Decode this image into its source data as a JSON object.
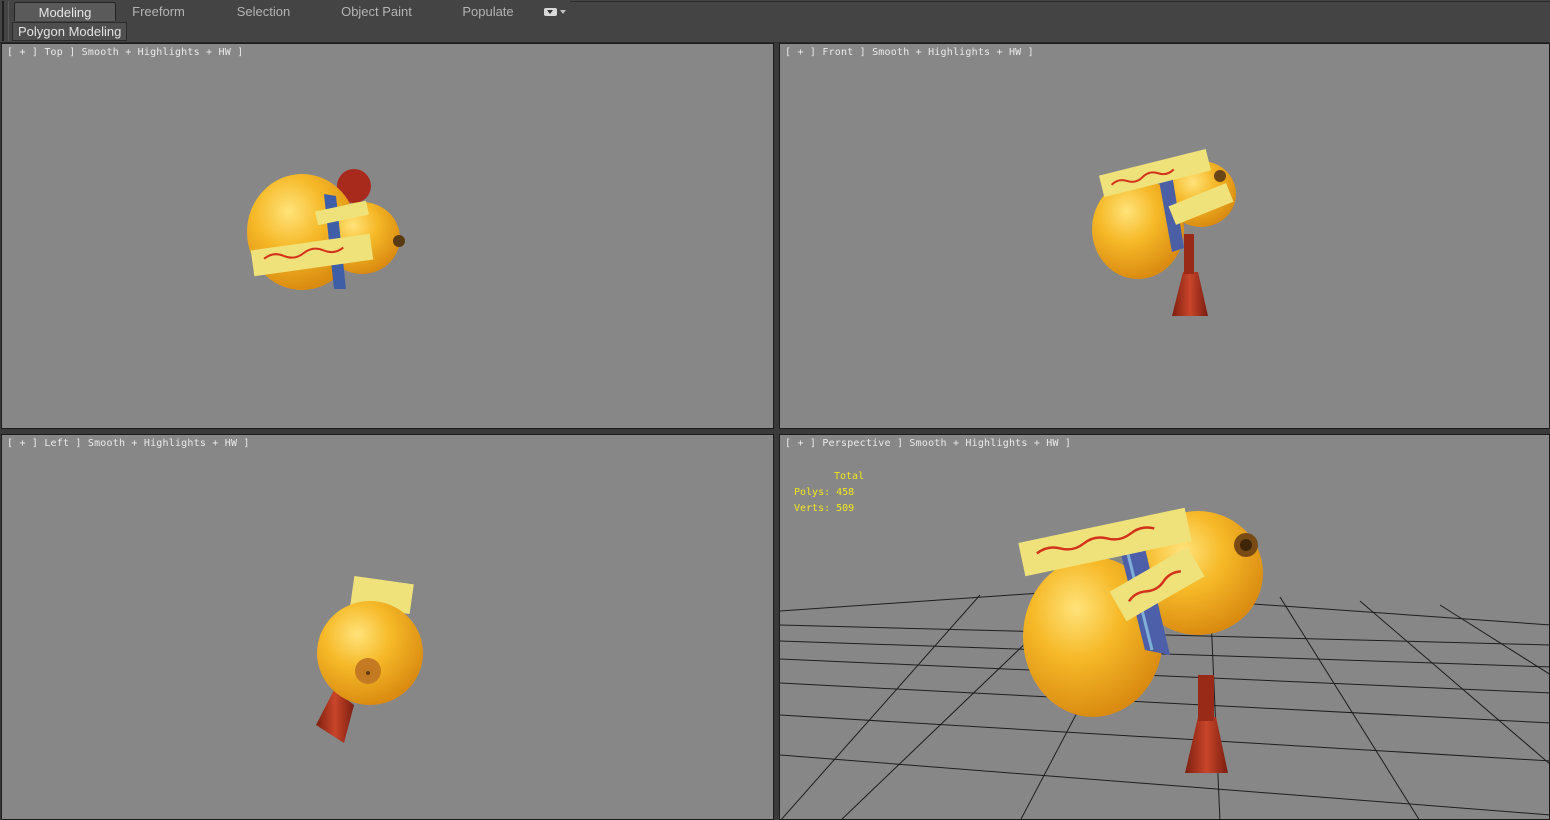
{
  "ribbon": {
    "tabs": [
      "Modeling",
      "Freeform",
      "Selection",
      "Object Paint",
      "Populate"
    ],
    "active_tab": "Modeling",
    "sub_tab": "Polygon Modeling",
    "dropdown_icon": "ribbon-options-icon"
  },
  "viewports": {
    "top": {
      "label": "[ + ] Top ] Smooth + Highlights + HW ]"
    },
    "front": {
      "label": "[ + ] Front ] Smooth + Highlights + HW ]"
    },
    "left": {
      "label": "[ + ] Left ] Smooth + Highlights + HW ]"
    },
    "persp": {
      "label": "[ + ] Perspective ] Smooth + Highlights + HW ]"
    }
  },
  "stats": {
    "total_label": "Total",
    "polys": "Polys: 458",
    "verts": "Verts: 509"
  },
  "colors": {
    "viewport_bg": "#878787",
    "stats_text": "#f2e71c",
    "gourd": "#f3b321",
    "tassel": "#b83a1f",
    "talisman": "#efe27a"
  }
}
